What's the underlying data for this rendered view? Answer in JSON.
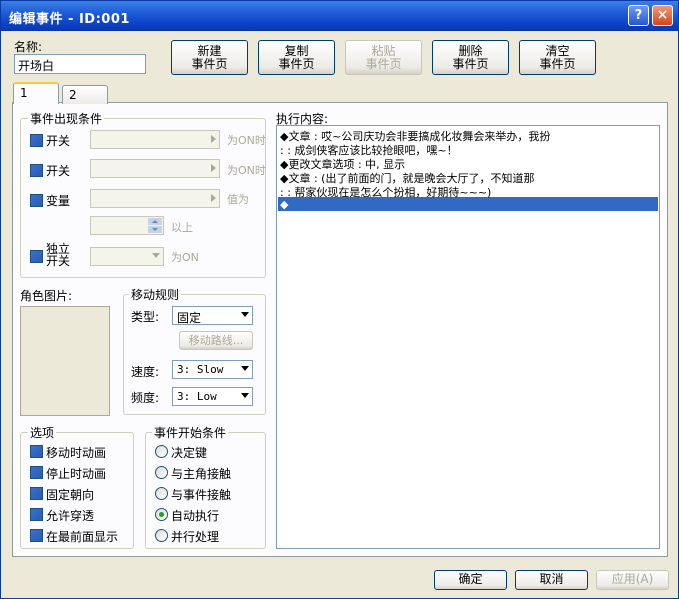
{
  "window": {
    "title": "编辑事件 - ID:001",
    "help": "?",
    "close": "×"
  },
  "name": {
    "label": "名称:",
    "value": "开场白"
  },
  "toolbar": [
    {
      "line1": "新建",
      "line2": "事件页",
      "enabled": true
    },
    {
      "line1": "复制",
      "line2": "事件页",
      "enabled": true
    },
    {
      "line1": "粘贴",
      "line2": "事件页",
      "enabled": false
    },
    {
      "line1": "删除",
      "line2": "事件页",
      "enabled": true
    },
    {
      "line1": "清空",
      "line2": "事件页",
      "enabled": true
    }
  ],
  "tabs": [
    {
      "label": "1"
    },
    {
      "label": "2"
    }
  ],
  "conditions": {
    "title": "事件出现条件",
    "switch1": {
      "label": "开关",
      "suffix": "为ON时"
    },
    "switch2": {
      "label": "开关",
      "suffix": "为ON时"
    },
    "variable": {
      "label": "变量",
      "suffix": "值为"
    },
    "above": "以上",
    "self_switch": {
      "label_line1": "独立",
      "label_line2": "开关",
      "suffix": "为ON"
    }
  },
  "graphic": {
    "title": "角色图片:"
  },
  "movement": {
    "title": "移动规则",
    "type_label": "类型:",
    "type_value": "固定",
    "route_button": "移动路线...",
    "speed_label": "速度:",
    "speed_value": "3: Slow",
    "freq_label": "频度:",
    "freq_value": "3: Low"
  },
  "options": {
    "title": "选项",
    "items": [
      {
        "label": "移动时动画",
        "checked": true
      },
      {
        "label": "停止时动画",
        "checked": true
      },
      {
        "label": "固定朝向",
        "checked": true
      },
      {
        "label": "允许穿透",
        "checked": true
      },
      {
        "label": "在最前面显示",
        "checked": true
      }
    ]
  },
  "trigger": {
    "title": "事件开始条件",
    "items": [
      {
        "label": "决定键",
        "selected": false
      },
      {
        "label": "与主角接触",
        "selected": false
      },
      {
        "label": "与事件接触",
        "selected": false
      },
      {
        "label": "自动执行",
        "selected": true
      },
      {
        "label": "并行处理",
        "selected": false
      }
    ]
  },
  "contents": {
    "title": "执行内容:",
    "lines": [
      "◆文章 : 哎~公司庆功会非要搞成化妆舞会来举办，我扮",
      ":      : 成剑侠客应该比较抢眼吧，嘿~！",
      "◆更改文章选项 : 中, 显示",
      "◆文章 : (出了前面的门，就是晚会大厅了，不知道那",
      ":      : 帮家伙现在是怎么个扮相，好期待~~~)",
      "◆"
    ]
  },
  "footer": {
    "ok": "确定",
    "cancel": "取消",
    "apply": "应用(A)"
  }
}
